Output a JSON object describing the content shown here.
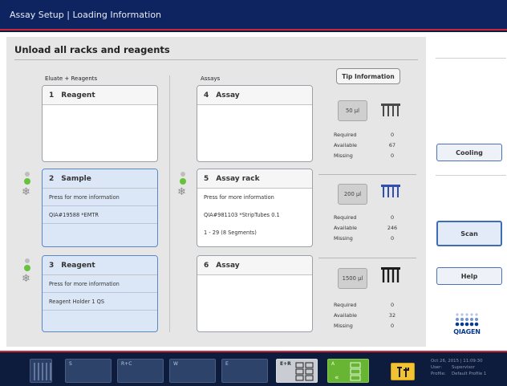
{
  "window": {
    "title": "Assay Setup | Loading Information"
  },
  "main": {
    "heading": "Unload all racks and reagents",
    "columns": {
      "left": "Eluate + Reagents",
      "middle": "Assays"
    }
  },
  "left_cards": [
    {
      "number": "1",
      "title": "Reagent",
      "rows": []
    },
    {
      "number": "2",
      "title": "Sample",
      "rows": [
        "Press for more information",
        "QIA#19588 *EMTR"
      ]
    },
    {
      "number": "3",
      "title": "Reagent",
      "rows": [
        "Press for more information",
        "Reagent Holder 1 QS"
      ]
    }
  ],
  "middle_cards": [
    {
      "number": "4",
      "title": "Assay",
      "rows": []
    },
    {
      "number": "5",
      "title": "Assay rack",
      "rows": [
        "Press for more information",
        "QIA#981103 *StripTubes 0.1",
        "1 - 29 (8 Segments)"
      ]
    },
    {
      "number": "6",
      "title": "Assay",
      "rows": []
    }
  ],
  "tips": {
    "button_label": "Tip Information",
    "labels": {
      "required": "Required",
      "available": "Available",
      "missing": "Missing"
    },
    "sections": [
      {
        "volume": "50 µl",
        "required": "0",
        "available": "67",
        "missing": "0",
        "icon": "tip-rack-icon",
        "color": "#4a4a4a"
      },
      {
        "volume": "200 µl",
        "required": "0",
        "available": "246",
        "missing": "0",
        "icon": "tip-rack-icon",
        "color": "#2f4fb5"
      },
      {
        "volume": "1500 µl",
        "required": "0",
        "available": "32",
        "missing": "0",
        "icon": "tip-rack-icon",
        "color": "#1b1b1b"
      }
    ]
  },
  "sidebar": {
    "cooling_label": "Cooling",
    "scan_label": "Scan",
    "help_label": "Help",
    "logo_text": "QIAGEN"
  },
  "footer": {
    "slots": [
      {
        "label": "",
        "kind": "drawer"
      },
      {
        "label": "S",
        "kind": "inactive"
      },
      {
        "label": "R+C",
        "kind": "inactive"
      },
      {
        "label": "W",
        "kind": "inactive"
      },
      {
        "label": "E",
        "kind": "inactive"
      },
      {
        "label": "E+R",
        "kind": "selected"
      },
      {
        "label": "A",
        "kind": "active"
      }
    ],
    "status": {
      "datetime": "Oct 26, 2015 | 11:09:30",
      "user_label": "User:",
      "user_value": "Supervisor",
      "profile_label": "Profile:",
      "profile_value": "Default Profile 1"
    }
  },
  "colors": {
    "title_bar": "#0e2461",
    "accent": "#c8283a",
    "active_card": "#dbe7f7",
    "indicator_on": "#66c23a",
    "tool_button": "#f1c232"
  }
}
